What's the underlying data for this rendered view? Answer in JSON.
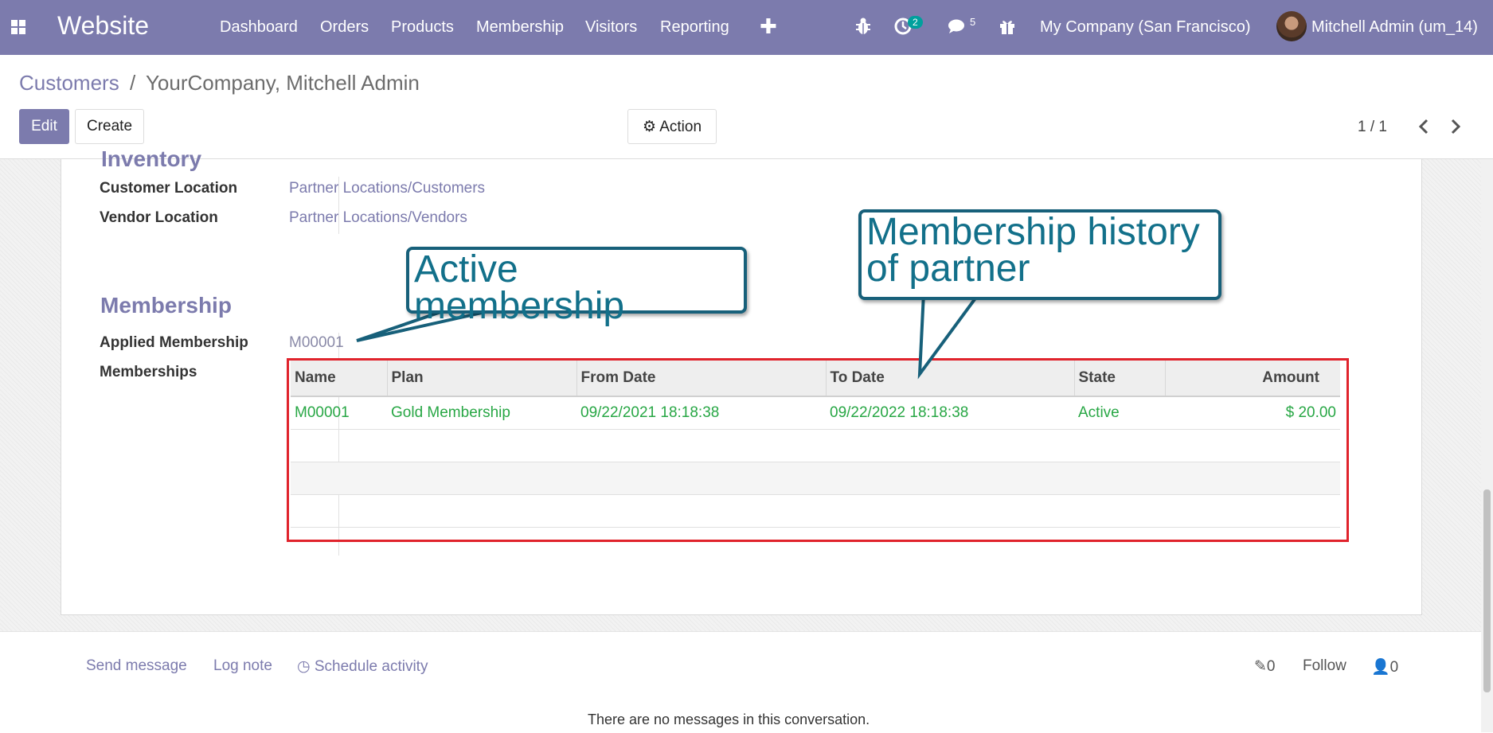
{
  "topbar": {
    "brand": "Website",
    "menu": [
      "Dashboard",
      "Orders",
      "Products",
      "Membership",
      "Visitors",
      "Reporting"
    ],
    "activity_count": "2",
    "message_count": "5",
    "company": "My Company (San Francisco)",
    "user": "Mitchell Admin (um_14)"
  },
  "breadcrumb": {
    "parent": "Customers",
    "separator": "/",
    "current": "YourCompany, Mitchell Admin"
  },
  "buttons": {
    "edit": "Edit",
    "create": "Create",
    "action": "Action"
  },
  "pager": {
    "value": "1 / 1"
  },
  "form": {
    "inventory_title": "Inventory",
    "customer_location_label": "Customer Location",
    "customer_location_value": "Partner Locations/Customers",
    "vendor_location_label": "Vendor Location",
    "vendor_location_value": "Partner Locations/Vendors",
    "membership_title": "Membership",
    "applied_membership_label": "Applied Membership",
    "applied_membership_value": "M00001",
    "memberships_label": "Memberships"
  },
  "table": {
    "headers": [
      "Name",
      "Plan",
      "From Date",
      "To Date",
      "State",
      "Amount"
    ],
    "rows": [
      [
        "M00001",
        "Gold Membership",
        "09/22/2021 18:18:38",
        "09/22/2022 18:18:38",
        "Active",
        "$ 20.00"
      ]
    ]
  },
  "annotations": {
    "active": "Active membership",
    "history_line1": "Membership history",
    "history_line2": "of partner"
  },
  "chatter": {
    "send_message": "Send message",
    "log_note": "Log note",
    "schedule_activity": "Schedule activity",
    "attachments": "0",
    "follow": "Follow",
    "followers": "0",
    "no_messages": "There are no messages in this conversation."
  },
  "colors": {
    "navbar": "#7c7bad",
    "accent": "#7c7bad",
    "success": "#28a745",
    "highlight": "#e0232c",
    "callout": "#17607a"
  }
}
